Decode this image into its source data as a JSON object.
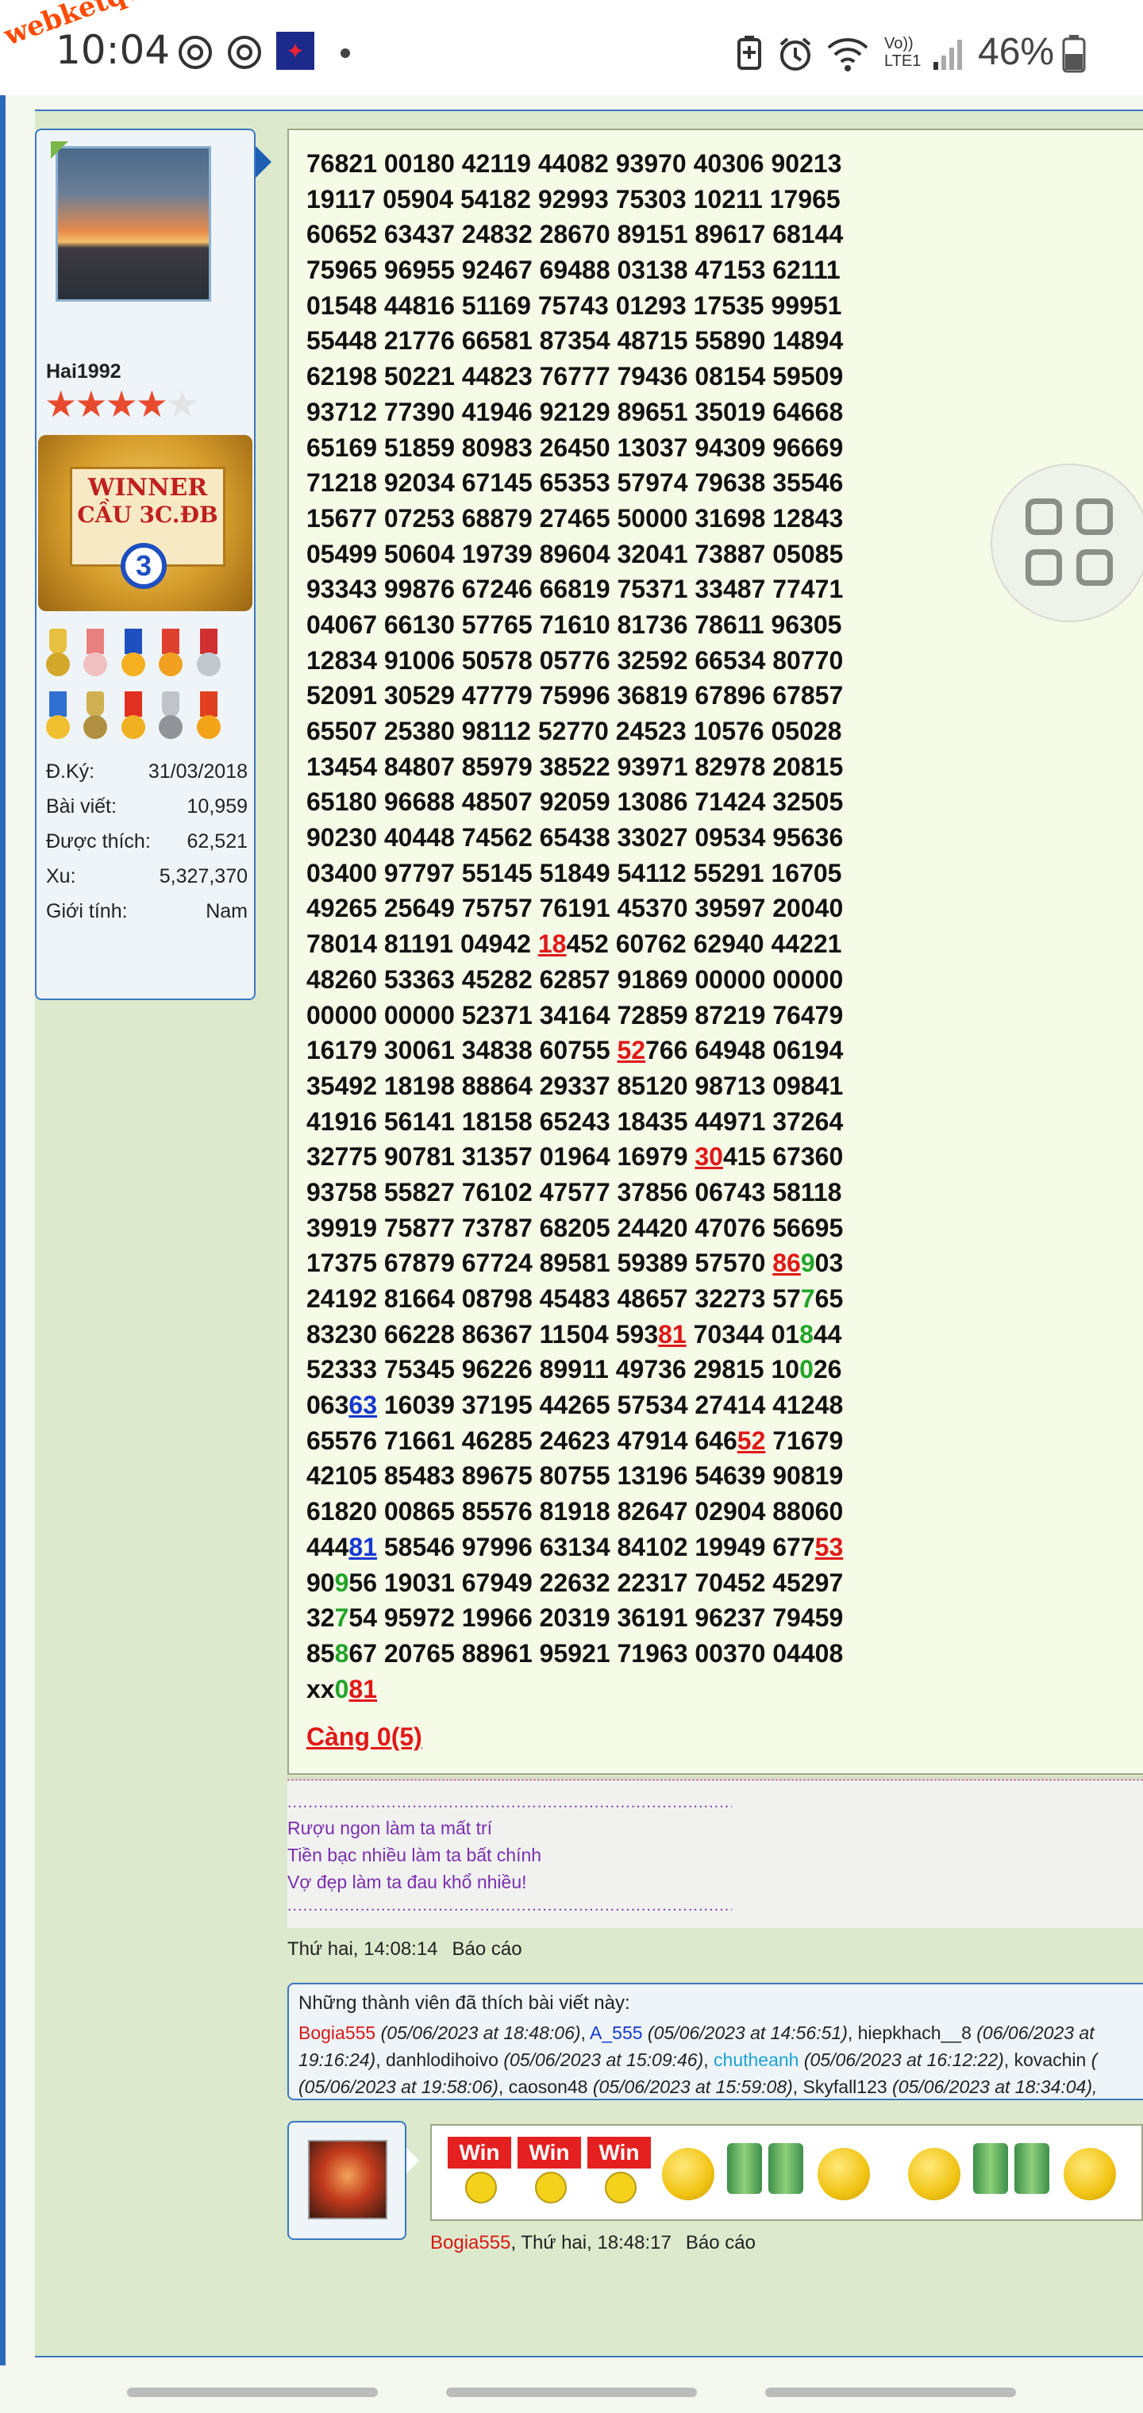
{
  "status_bar": {
    "watermark": "webketqua.net",
    "time": "10:04",
    "network": "Vo)) LTE1",
    "battery_percent": "46%",
    "icons": [
      "chrome-icon",
      "chrome-icon",
      "flag-icon",
      "dot-icon",
      "battery-saver-icon",
      "alarm-icon",
      "wifi-icon",
      "signal-icon",
      "battery-icon"
    ]
  },
  "user": {
    "name": "Hai1992",
    "stars_filled": 4,
    "stars_total": 5,
    "award": {
      "line1": "WINNER",
      "line2": "CẦU 3C.ĐB",
      "number": "3"
    },
    "stats": [
      {
        "label": "Đ.Ký:",
        "value": "31/03/2018"
      },
      {
        "label": "Bài viết:",
        "value": "10,959"
      },
      {
        "label": "Được thích:",
        "value": "62,521"
      },
      {
        "label": "Xu:",
        "value": "5,327,370"
      },
      {
        "label": "Giới tính:",
        "value": "Nam"
      }
    ]
  },
  "post": {
    "lines": [
      [
        {
          "t": "76821 00180 42119 44082 93970 40306 90213"
        }
      ],
      [
        {
          "t": "19117 05904 54182 92993 75303 10211 17965"
        }
      ],
      [
        {
          "t": "60652 63437 24832 28670 89151 89617 68144"
        }
      ],
      [
        {
          "t": "75965 96955 92467 69488 03138 47153 62111"
        }
      ],
      [
        {
          "t": "01548 44816 51169 75743 01293 17535 99951"
        }
      ],
      [
        {
          "t": "55448 21776 66581 87354 48715 55890 14894"
        }
      ],
      [
        {
          "t": "62198 50221 44823 76777 79436 08154 59509"
        }
      ],
      [
        {
          "t": "93712 77390 41946 92129 89651 35019 64668"
        }
      ],
      [
        {
          "t": "65169 51859 80983 26450 13037 94309 96669"
        }
      ],
      [
        {
          "t": "71218 92034 67145 65353 57974 79638 35546"
        }
      ],
      [
        {
          "t": "15677 07253 68879 27465 50000 31698 12843"
        }
      ],
      [
        {
          "t": "05499 50604 19739 89604 32041 73887 05085"
        }
      ],
      [
        {
          "t": "93343 99876 67246 66819 75371 33487 77471"
        }
      ],
      [
        {
          "t": "04067 66130 57765 71610 81736 78611 96305"
        }
      ],
      [
        {
          "t": "12834 91006 50578 05776 32592 66534 80770"
        }
      ],
      [
        {
          "t": "52091 30529 47779 75996 36819 67896 67857"
        }
      ],
      [
        {
          "t": "65507 25380 98112 52770 24523 10576 05028"
        }
      ],
      [
        {
          "t": "13454 84807 85979 38522 93971 82978 20815"
        }
      ],
      [
        {
          "t": "65180 96688 48507 92059 13086 71424 32505"
        }
      ],
      [
        {
          "t": "90230 40448 74562 65438 33027 09534 95636"
        }
      ],
      [
        {
          "t": "03400 97797 55145 51849 54112 55291 16705"
        }
      ],
      [
        {
          "t": "49265 25649 75757 76191 45370 39597 20040"
        }
      ],
      [
        {
          "t": "78014 81191 04942 "
        },
        {
          "t": "18",
          "c": "red"
        },
        {
          "t": "452 60762 62940 44221"
        }
      ],
      [
        {
          "t": "48260 53363 45282 62857 91869 00000 00000"
        }
      ],
      [
        {
          "t": "00000 00000 52371 34164 72859 87219 76479"
        }
      ],
      [
        {
          "t": "16179 30061 34838 60755 "
        },
        {
          "t": "52",
          "c": "red"
        },
        {
          "t": "766 64948 06194"
        }
      ],
      [
        {
          "t": "35492 18198 88864 29337 85120 98713 09841"
        }
      ],
      [
        {
          "t": "41916 56141 18158 65243 18435 44971 37264"
        }
      ],
      [
        {
          "t": "32775 90781 31357 01964 16979 "
        },
        {
          "t": "30",
          "c": "red"
        },
        {
          "t": "415 67360"
        }
      ],
      [
        {
          "t": "93758 55827 76102 47577 37856 06743 58118"
        }
      ],
      [
        {
          "t": "39919 75877 73787 68205 24420 47076 56695"
        }
      ],
      [
        {
          "t": "17375 67879 67724 89581 59389 57570 "
        },
        {
          "t": "86",
          "c": "red"
        },
        {
          "t": "9",
          "c": "green"
        },
        {
          "t": "03"
        }
      ],
      [
        {
          "t": "24192 81664 08798 45483 48657 32273 57"
        },
        {
          "t": "7",
          "c": "green"
        },
        {
          "t": "65"
        }
      ],
      [
        {
          "t": "83230 66228 86367 11504 593"
        },
        {
          "t": "81",
          "c": "red"
        },
        {
          "t": " 70344 01"
        },
        {
          "t": "8",
          "c": "green"
        },
        {
          "t": "44"
        }
      ],
      [
        {
          "t": "52333 75345 96226 89911 49736 29815 10"
        },
        {
          "t": "0",
          "c": "green"
        },
        {
          "t": "26"
        }
      ],
      [
        {
          "t": "063"
        },
        {
          "t": "63",
          "c": "blue"
        },
        {
          "t": " 16039 37195 44265 57534 27414 41248"
        }
      ],
      [
        {
          "t": "65576 71661 46285 24623 47914 646"
        },
        {
          "t": "52",
          "c": "red"
        },
        {
          "t": " 71679"
        }
      ],
      [
        {
          "t": "42105 85483 89675 80755 13196 54639 90819"
        }
      ],
      [
        {
          "t": "61820 00865 85576 81918 82647 02904 88060"
        }
      ],
      [
        {
          "t": "444"
        },
        {
          "t": "81",
          "c": "blue"
        },
        {
          "t": " 58546 97996 63134 84102 19949 677"
        },
        {
          "t": "53",
          "c": "red"
        }
      ],
      [
        {
          "t": "90"
        },
        {
          "t": "9",
          "c": "green"
        },
        {
          "t": "56 19031 67949 22632 22317 70452 45297"
        }
      ],
      [
        {
          "t": "32"
        },
        {
          "t": "7",
          "c": "green"
        },
        {
          "t": "54 95972 19966 20319 36191 96237 79459"
        }
      ],
      [
        {
          "t": "85"
        },
        {
          "t": "8",
          "c": "green"
        },
        {
          "t": "67 20765 88961 95921 71963 00370 04408"
        }
      ],
      [
        {
          "t": "xx"
        },
        {
          "t": "0",
          "c": "green"
        },
        {
          "t": "81",
          "c": "red"
        }
      ]
    ],
    "cang": "Càng 0(5)",
    "signature": {
      "dots": "..................................................................................................",
      "lines": [
        "Rượu ngon làm ta mất trí",
        "Tiền bạc nhiều làm ta bất chính",
        "Vợ đẹp làm ta đau khổ nhiều!"
      ]
    },
    "time": "Thứ hai, 14:08:14",
    "report": "Báo cáo"
  },
  "likes": {
    "title": "Những thành viên đã thích bài viết này:",
    "line1": [
      {
        "n": "Bogia555",
        "c": "red",
        "d": " (05/06/2023 at 18:48:06)"
      },
      {
        "n": "A_555",
        "c": "blue",
        "d": " (05/06/2023 at 14:56:51)"
      },
      {
        "n": "hiepkhach__8",
        "c": "",
        "d": " (06/06/2023 at"
      }
    ],
    "line2": [
      {
        "n": "",
        "c": "",
        "d": "19:16:24)"
      },
      {
        "n": "danhlodihoivo",
        "c": "",
        "d": " (05/06/2023 at 15:09:46)"
      },
      {
        "n": "chutheanh",
        "c": "cyan",
        "d": " (05/06/2023 at 16:12:22)"
      },
      {
        "n": "kovachin",
        "c": "",
        "d": " ("
      }
    ],
    "line3": [
      {
        "n": "",
        "c": "",
        "d": "(05/06/2023 at 19:58:06)"
      },
      {
        "n": "caoson48",
        "c": "",
        "d": " (05/06/2023 at 15:59:08)"
      },
      {
        "n": "Skyfall123",
        "c": "",
        "d": " (05/06/2023 at 18:34:04),"
      }
    ]
  },
  "reply": {
    "win_label": "Win",
    "author": "Bogia555",
    "time": ", Thứ hai, 18:48:17",
    "report": "Báo cáo"
  }
}
